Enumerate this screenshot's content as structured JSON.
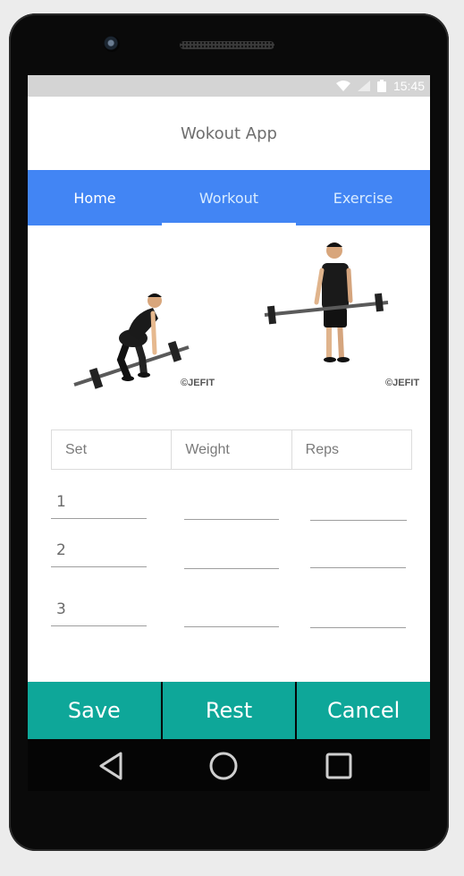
{
  "status_bar": {
    "time": "15:45",
    "icons": [
      "wifi-icon",
      "signal-icon",
      "battery-icon"
    ]
  },
  "app": {
    "title": "Wokout App"
  },
  "tabs": [
    {
      "label": "Home",
      "color": "#ffffff"
    },
    {
      "label": "Workout",
      "color": "#d9ecff",
      "selected": true
    },
    {
      "label": "Exercise",
      "color": "#d9ecff"
    }
  ],
  "exercise_images": {
    "watermark_left": "JEFIT",
    "watermark_right": "JEFIT"
  },
  "table": {
    "headers": [
      "Set",
      "Weight",
      "Reps"
    ],
    "rows": [
      {
        "set": "1",
        "weight": "",
        "reps": ""
      },
      {
        "set": "2",
        "weight": "",
        "reps": ""
      },
      {
        "set": "3",
        "weight": "",
        "reps": ""
      }
    ]
  },
  "actions": {
    "save": "Save",
    "rest": "Rest",
    "cancel": "Cancel"
  },
  "colors": {
    "tab_bar": "#4285f4",
    "button": "#0ea799",
    "status_bar": "#d4d4d4"
  }
}
